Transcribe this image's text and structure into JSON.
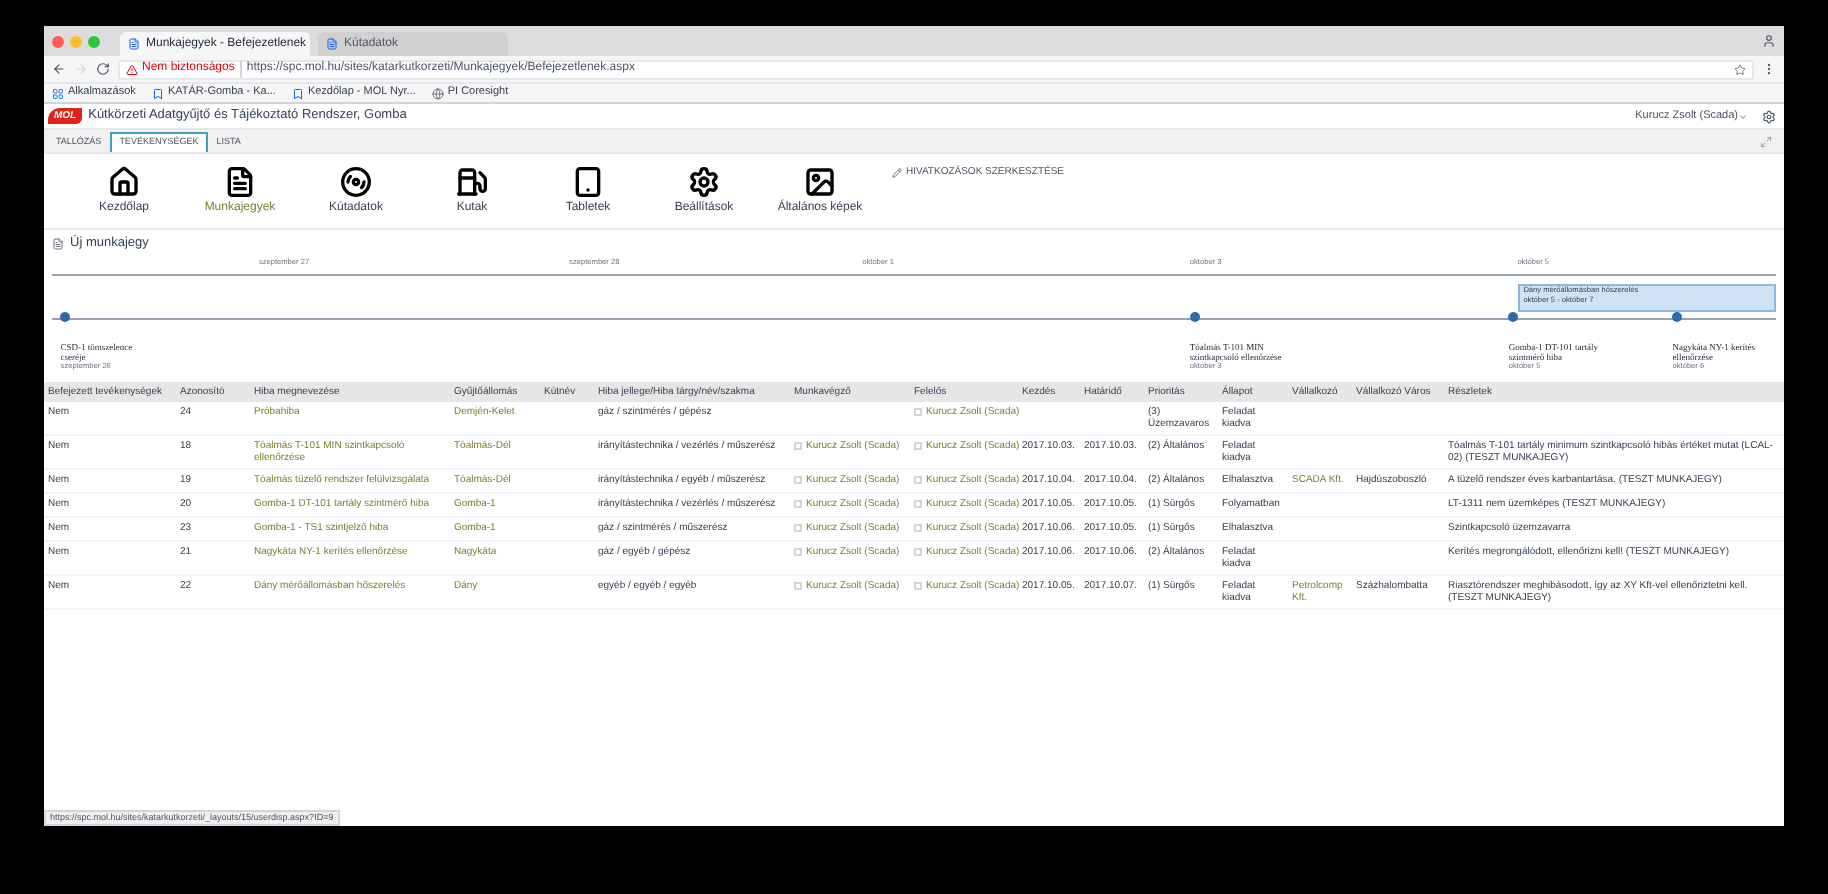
{
  "browser": {
    "tabs": [
      {
        "label": "Munkajegyek - Befejezetlenek",
        "selected": true
      },
      {
        "label": "Kútadatok",
        "selected": false
      }
    ],
    "address": {
      "warning": "Nem biztonságos",
      "url": "https://spc.mol.hu/sites/katarkutkorzeti/Munkajegyek/Befejezetlenek.aspx"
    },
    "bookmarks": [
      "Alkalmazások",
      "KATÁR-Gomba - Ka...",
      "Kezdőlap - MOL Nyr...",
      "PI Coresight"
    ]
  },
  "app": {
    "logo": "MOL",
    "title": "Kútkörzeti Adatgyűjtő és Tájékoztató Rendszer, Gomba",
    "user": "Kurucz Zsolt (Scada)"
  },
  "ribbon_tabs": [
    {
      "label": "TALLÓZÁS",
      "selected": false
    },
    {
      "label": "TEVÉKENYSÉGEK",
      "selected": true
    },
    {
      "label": "LISTA",
      "selected": false
    }
  ],
  "toolbar": [
    {
      "label": "Kezdőlap",
      "kind": "home",
      "selected": false
    },
    {
      "label": "Munkajegyek",
      "kind": "doc",
      "selected": true
    },
    {
      "label": "Kútadatok",
      "kind": "disc",
      "selected": false
    },
    {
      "label": "Kutak",
      "kind": "pump",
      "selected": false
    },
    {
      "label": "Tabletek",
      "kind": "tablet",
      "selected": false
    },
    {
      "label": "Beállítások",
      "kind": "gear",
      "selected": false
    },
    {
      "label": "Általános képek",
      "kind": "image",
      "selected": false
    }
  ],
  "edit_links": "HIVATKOZÁSOK SZERKESZTÉSE",
  "new_item": "Új munkajegy",
  "timeline": {
    "dates": [
      "szeptember 27",
      "szeptember 28",
      "október 1",
      "október 3",
      "október 5"
    ],
    "range": {
      "title": "Dány mérőállomásban hőszerelés",
      "dates": "október 5 - október 7"
    },
    "events": [
      {
        "title": "CSD-1 tömszelence cseréje",
        "date": "szeptember 26"
      },
      {
        "title": "Tóalmás T-101 MIN szintkapcsoló ellenőrzése",
        "date": "október 3"
      },
      {
        "title": "Gomba-1 DT-101 tartály szintmérő hiba",
        "date": "október 5"
      },
      {
        "title": "Nagykáta NY-1 kerítés ellenőrzése",
        "date": "október 6"
      }
    ]
  },
  "table": {
    "columns": [
      {
        "label": "Befejezett tevékenységek",
        "kind": "text"
      },
      {
        "label": "Azonosító",
        "kind": "text"
      },
      {
        "label": "Hiba megnevezése",
        "kind": "link"
      },
      {
        "label": "Gyűjtőállomás",
        "kind": "link"
      },
      {
        "label": "Kútnév"
      },
      {
        "label": "Hiba jellege/Hiba tárgy/név/szakma",
        "kind": "text"
      },
      {
        "label": "Munkavégző",
        "kind": "person"
      },
      {
        "label": "Felelős",
        "kind": "person"
      },
      {
        "label": "Kezdés",
        "kind": "text"
      },
      {
        "label": "Határidő",
        "kind": "text"
      },
      {
        "label": "Prioritás",
        "kind": "text"
      },
      {
        "label": "Állapot",
        "kind": "text"
      },
      {
        "label": "Vállalkozó",
        "kind": "link"
      },
      {
        "label": "Vállalkozó Város",
        "kind": "text"
      },
      {
        "label": "Részletek",
        "kind": "text"
      }
    ],
    "rows": [
      [
        "Nem",
        "24",
        "Próbahiba",
        "Demjén-Kelet",
        "",
        "gáz / szintmérés / gépész",
        "",
        "Kurucz Zsolt (Scada)",
        "",
        "",
        "(3) Üzemzavaros",
        "Feladat kiadva",
        "",
        "",
        ""
      ],
      [
        "Nem",
        "18",
        "Tóalmás T-101 MIN szintkapcsoló ellenőrzése",
        "Tóalmás-Dél",
        "",
        "irányítástechnika / vezérlés / műszerész",
        "Kurucz Zsolt (Scada)",
        "Kurucz Zsolt (Scada)",
        "2017.10.03.",
        "2017.10.03.",
        "(2) Általános",
        "Feladat kiadva",
        "",
        "",
        "Tóalmás T-101 tartály minimum szintkapcsoló hibás értéket mutat (LCAL-02) (TESZT MUNKAJEGY)"
      ],
      [
        "Nem",
        "19",
        "Tóalmás tüzelő rendszer felülvizsgálata",
        "Tóalmás-Dél",
        "",
        "irányítástechnika / egyéb / műszerész",
        "Kurucz Zsolt (Scada)",
        "Kurucz Zsolt (Scada)",
        "2017.10.04.",
        "2017.10.04.",
        "(2) Általános",
        "Elhalasztva",
        "SCADA Kft.",
        "Hajdúszoboszló",
        "A tüzelő rendszer éves karbantartása. (TESZT MUNKAJEGY)"
      ],
      [
        "Nem",
        "20",
        "Gomba-1 DT-101 tartály szintmérő hiba",
        "Gomba-1",
        "",
        "irányítástechnika / vezérlés / műszerész",
        "Kurucz Zsolt (Scada)",
        "Kurucz Zsolt (Scada)",
        "2017.10.05.",
        "2017.10.05.",
        "(1) Sürgős",
        "Folyamatban",
        "",
        "",
        "LT-1311 nem üzemképes (TESZT MUNKAJEGY)"
      ],
      [
        "Nem",
        "23",
        "Gomba-1 - TS1 szintjelző hiba",
        "Gomba-1",
        "",
        "gáz / szintmérés / műszerész",
        "Kurucz Zsolt (Scada)",
        "Kurucz Zsolt (Scada)",
        "2017.10.06.",
        "2017.10.05.",
        "(1) Sürgős",
        "Elhalasztva",
        "",
        "",
        "Szintkapcsoló üzemzavarra"
      ],
      [
        "Nem",
        "21",
        "Nagykáta NY-1 kerítés ellenőrzése",
        "Nagykáta",
        "",
        "gáz / egyéb / gépész",
        "Kurucz Zsolt (Scada)",
        "Kurucz Zsolt (Scada)",
        "2017.10.06.",
        "2017.10.06.",
        "(2) Általános",
        "Feladat kiadva",
        "",
        "",
        "Kerítés megrongálódott, ellenőrizni kell! (TESZT MUNKAJEGY)"
      ],
      [
        "Nem",
        "22",
        "Dány mérőállomásban hőszerelés",
        "Dány",
        "",
        "egyéb / egyéb / egyéb",
        "Kurucz Zsolt (Scada)",
        "Kurucz Zsolt (Scada)",
        "2017.10.05.",
        "2017.10.07.",
        "(1) Sürgős",
        "Feladat kiadva",
        "Petrolcomp Kft.",
        "Százhalombatta",
        "Riasztórendszer meghibásodott, így az XY Kft-vel ellenőriztetni kell. (TESZT MUNKAJEGY)"
      ]
    ]
  },
  "status_url": "https://spc.mol.hu/sites/katarkutkorzeti/_layouts/15/userdisp.aspx?ID=9"
}
